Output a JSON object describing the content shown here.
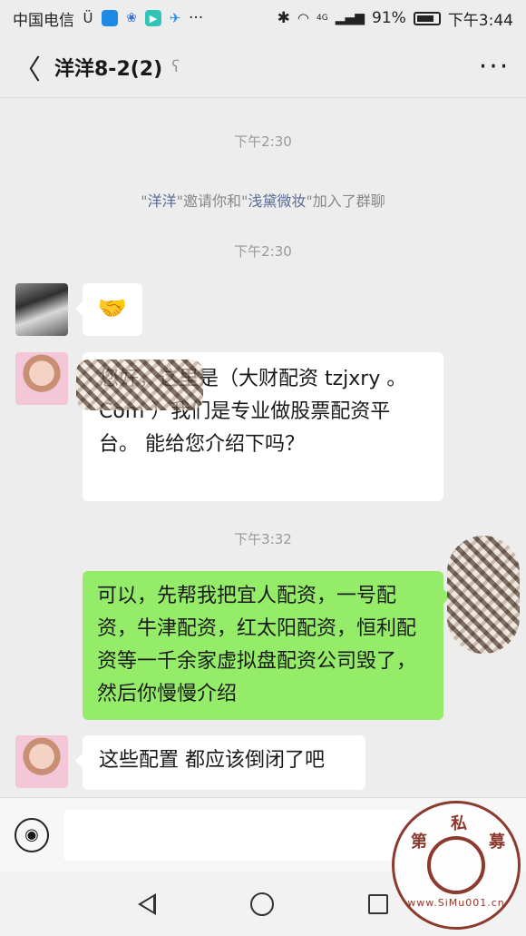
{
  "status_bar": {
    "carrier": "中国电信",
    "battery": "91%",
    "time": "下午3:44",
    "net_badge": "4G",
    "more": "···"
  },
  "nav": {
    "back": "〈",
    "title": "洋洋8-2(2)",
    "more": "···"
  },
  "messages": {
    "time1": "下午2:30",
    "sys": {
      "q1": "\"",
      "name1": "洋洋",
      "q2": "\"",
      "mid": "邀请你和",
      "q3": "\"",
      "name2": "浅黛微妆",
      "q4": "\"",
      "tail": "加入了群聊"
    },
    "time2": "下午2:30",
    "handshake": "🤝",
    "msg2": "您好，这里是（大财配资 tzjxry 。Com ）我们是专业做股票配资平台。 能给您介绍下吗？",
    "time3": "下午3:32",
    "msg3": "可以，先帮我把宜人配资，一号配资，牛津配资，红太阳配资，恒利配资等一千余家虚拟盘配资公司毁了，然后你慢慢介绍",
    "msg4": "这些配置 都应该倒闭了吧"
  },
  "input": {
    "voice_icon": "◉"
  },
  "watermark": {
    "chars": [
      "第",
      "私",
      "募"
    ],
    "site": "www.SiMu001.cn"
  },
  "colors": {
    "bg": "#ededed",
    "bubble_out": "#95ec69",
    "bubble_in": "#ffffff",
    "link": "#576b95"
  }
}
